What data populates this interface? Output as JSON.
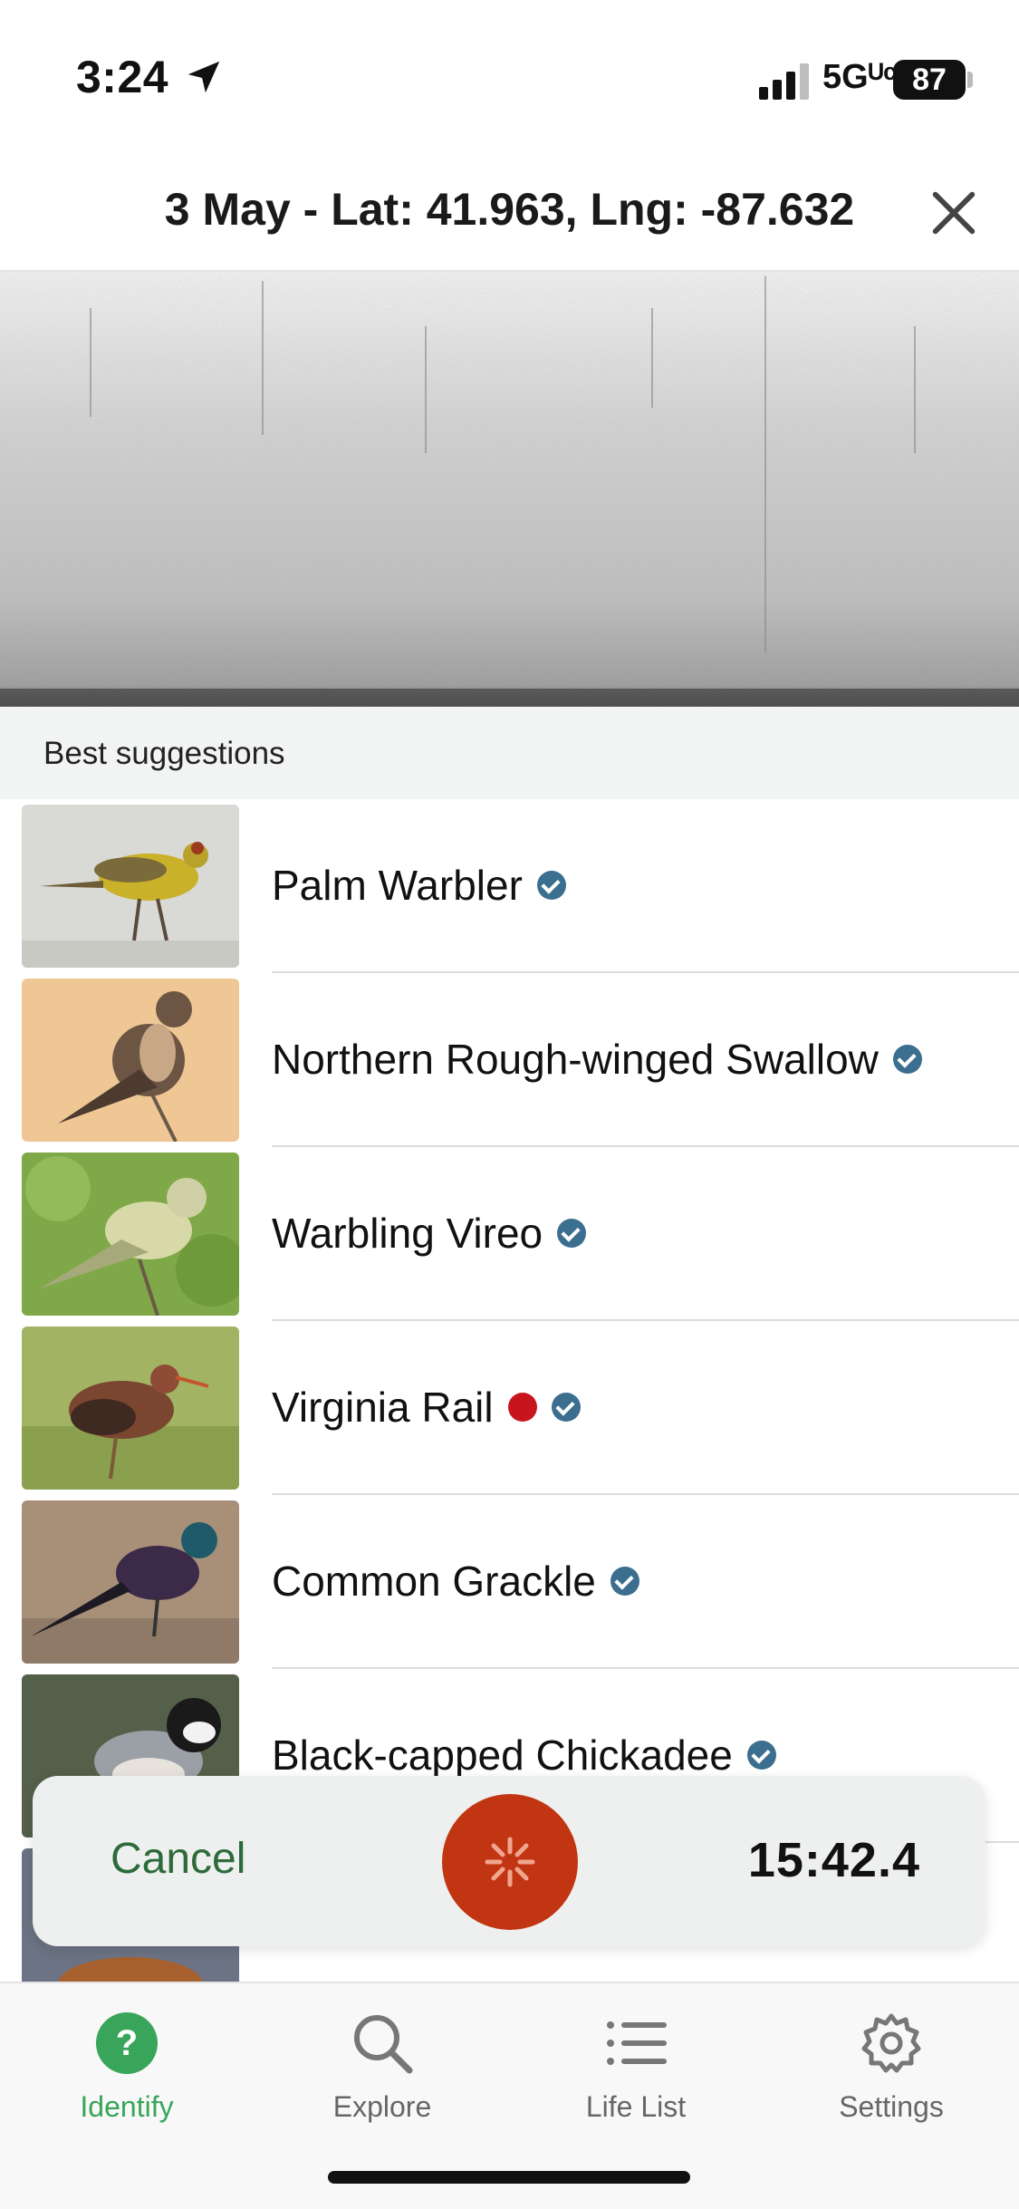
{
  "status_bar": {
    "time": "3:24",
    "network": "5Gᵁᶜ",
    "battery": "87"
  },
  "header": {
    "title": "3 May - Lat: 41.963, Lng: -87.632"
  },
  "section": {
    "label": "Best suggestions"
  },
  "suggestions": [
    {
      "name": "Palm Warbler",
      "verified": true,
      "red_dot": false
    },
    {
      "name": "Northern Rough-winged Swallow",
      "verified": true,
      "red_dot": false
    },
    {
      "name": "Warbling Vireo",
      "verified": true,
      "red_dot": false
    },
    {
      "name": "Virginia Rail",
      "verified": true,
      "red_dot": true
    },
    {
      "name": "Common Grackle",
      "verified": true,
      "red_dot": false
    },
    {
      "name": "Black-capped Chickadee",
      "verified": true,
      "red_dot": false
    }
  ],
  "recorder": {
    "cancel_label": "Cancel",
    "timer": "15:42.4"
  },
  "tabs": [
    {
      "label": "Identify",
      "icon": "question-icon",
      "active": true
    },
    {
      "label": "Explore",
      "icon": "search-icon",
      "active": false
    },
    {
      "label": "Life List",
      "icon": "list-icon",
      "active": false
    },
    {
      "label": "Settings",
      "icon": "gear-icon",
      "active": false
    }
  ],
  "colors": {
    "accent_green": "#39a55a",
    "record_red": "#c23512",
    "verified_blue": "#3b6e8f",
    "rare_red": "#c8151d"
  }
}
